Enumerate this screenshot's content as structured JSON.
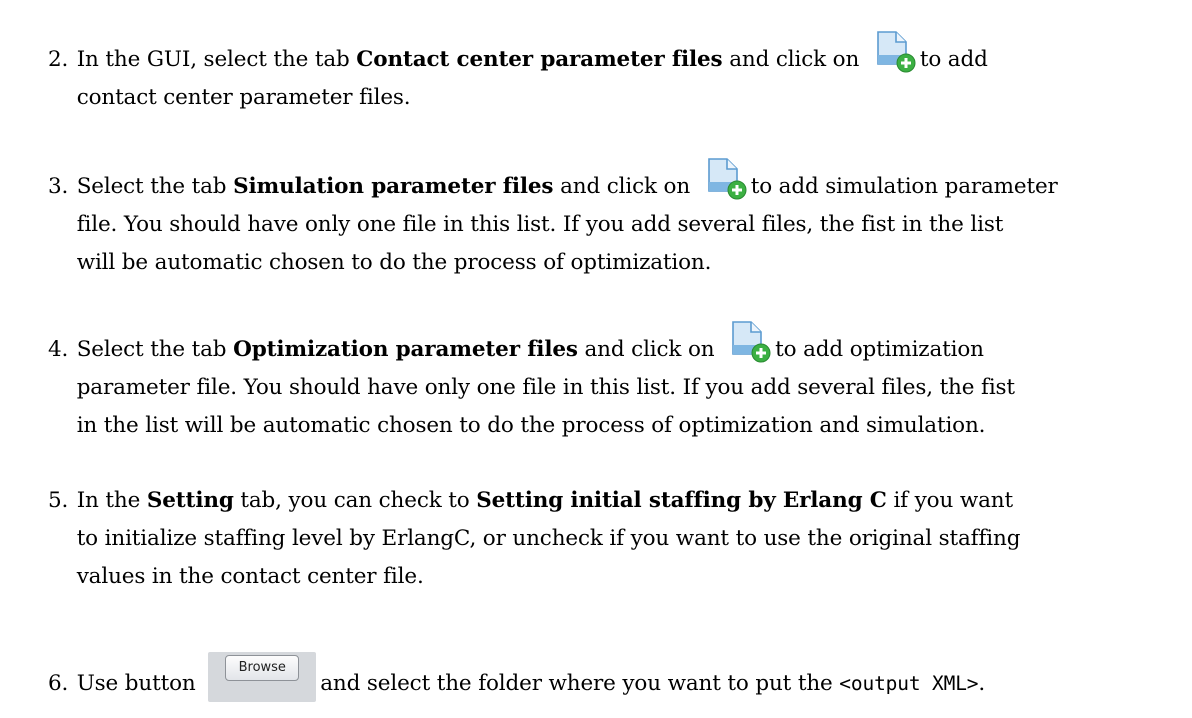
{
  "items": [
    {
      "number": "2.",
      "parts": {
        "a": "In the GUI, select the tab ",
        "b_bold": "Contact center parameter files",
        "c": " and click on ",
        "d": "to add",
        "e": "contact center parameter files."
      }
    },
    {
      "number": "3.",
      "parts": {
        "a": "Select the tab ",
        "b_bold": "Simulation parameter files",
        "c": " and click on ",
        "d": "to add simulation parameter",
        "e": "file. You should have only one file in this list. If you add several files, the fist in the list",
        "f": "will be automatic chosen to do the process of optimization."
      }
    },
    {
      "number": "4.",
      "parts": {
        "a": "Select the tab ",
        "b_bold": "Optimization parameter files",
        "c": " and click on ",
        "d": "to add optimization",
        "e": "parameter file. You should have only one file in this list. If you add several files, the fist",
        "f": "in the list will be automatic chosen to do the process of optimization and simulation."
      }
    },
    {
      "number": "5.",
      "parts": {
        "a": "In the ",
        "b_bold": "Setting",
        "c": " tab, you can check to ",
        "d_bold": "Setting initial staffing by Erlang C",
        "e": " if you want",
        "f": "to initialize staffing level by ErlangC, or uncheck if you want to use the original staffing",
        "g": "values in the contact center file."
      }
    },
    {
      "number": "6.",
      "parts": {
        "a": "Use button ",
        "button_label": "Browse",
        "b": "and select the folder where you want to put the ",
        "c_code": "<output XML>",
        "d": "."
      }
    }
  ],
  "icons": {
    "add_file": "add-file-icon",
    "colors": {
      "page": "#d6e8f7",
      "page_border": "#5b9bd0",
      "plus_circle": "#3cb043"
    }
  }
}
